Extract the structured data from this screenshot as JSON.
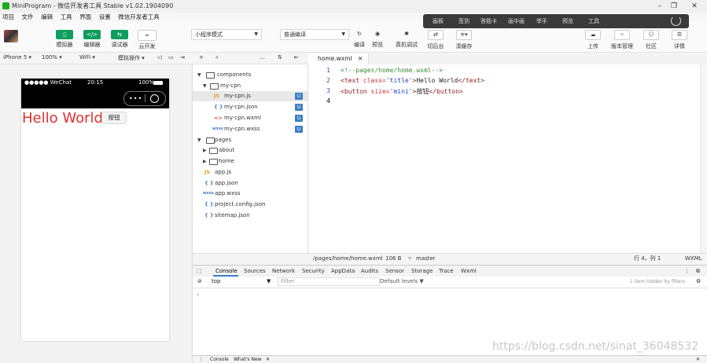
{
  "window": {
    "title": "MiniProgram - 微信开发者工具 Stable v1.02.1904090"
  },
  "menu": [
    "项目",
    "文件",
    "编辑",
    "工具",
    "界面",
    "设置",
    "微信开发者工具"
  ],
  "overlay_items": [
    "画板",
    "签到",
    "答题卡",
    "画中画",
    "举手",
    "预览",
    "工具"
  ],
  "toolbar": {
    "simulator": "模拟器",
    "editor": "编辑器",
    "debugger": "调试器",
    "cloud": "云开发",
    "mode_select": "小程序模式",
    "compile_select": "普通编译",
    "compile": "编译",
    "preview": "预览",
    "remote_debug": "真机调试",
    "switch_bg": "切后台",
    "clear_cache": "清缓存",
    "upload": "上传",
    "version_mgmt": "版本管理",
    "community": "社区",
    "details": "详情"
  },
  "subbar": {
    "device": "iPhone 5",
    "zoom": "100%",
    "network": "WiFi",
    "simulate_ops": "模拟操作"
  },
  "phone": {
    "carrier": "●●●●● WeChat",
    "time": "20:15",
    "battery": "100%",
    "capsule_dots": "•••",
    "hello_text": "Hello World",
    "button_text": "按钮"
  },
  "tree": {
    "components": "components",
    "my_cpn_folder": "my-cpn",
    "files_cpn": [
      {
        "icon": "JS",
        "name": "my-cpn.js",
        "badge": "U"
      },
      {
        "icon": "{ }",
        "name": "my-cpn.json",
        "badge": "U"
      },
      {
        "icon": "<>",
        "name": "my-cpn.wxml",
        "badge": "U"
      },
      {
        "icon": "wxss",
        "name": "my-cpn.wxss",
        "badge": "U"
      }
    ],
    "pages": "pages",
    "about": "about",
    "home": "home",
    "root_files": [
      {
        "icon": "JS",
        "name": "app.js"
      },
      {
        "icon": "{ }",
        "name": "app.json"
      },
      {
        "icon": "wxss",
        "name": "app.wxss"
      },
      {
        "icon": "{ }",
        "name": "project.config.json"
      },
      {
        "icon": "{ }",
        "name": "sitemap.json"
      }
    ]
  },
  "editor": {
    "tab": "home.wxml",
    "line_numbers": [
      "1",
      "2",
      "3",
      "4"
    ],
    "line1_comment": "<!--pages/home/home.wxml-->",
    "line2": {
      "open": "<text ",
      "attr": "class=",
      "val": "'title'",
      "close": ">",
      "text": "Hello World",
      "end": "</text>"
    },
    "line3": {
      "open": "<button ",
      "attr": "size=",
      "val": "'mini'",
      "close": ">",
      "text": "按钮",
      "end": "</button>"
    },
    "status_path": "/pages/home/home.wxml",
    "status_size": "106 B",
    "status_branch": "master",
    "status_pos": "行 4，列 1",
    "status_lang": "WXML"
  },
  "devtools": {
    "tabs": [
      "Console",
      "Sources",
      "Network",
      "Security",
      "AppData",
      "Audits",
      "Sensor",
      "Storage",
      "Trace",
      "Wxml"
    ],
    "context": "top",
    "filter_placeholder": "Filter",
    "levels": "Default levels ▼",
    "hidden_info": "1 item hidden by filters",
    "prompt": "›",
    "bottom_tabs": [
      "Console",
      "What's New"
    ]
  },
  "watermark": "https://blog.csdn.net/sinat_36048532"
}
